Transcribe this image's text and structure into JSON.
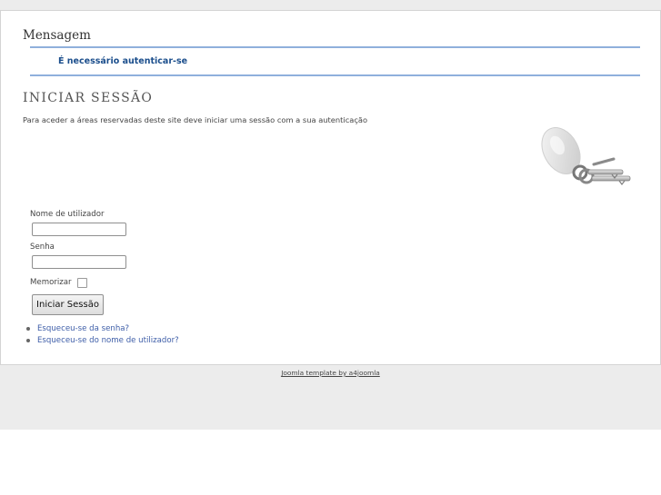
{
  "message": {
    "title": "Mensagem",
    "text": "É necessário autenticar-se"
  },
  "login": {
    "heading": "INICIAR SESSÃO",
    "description": "Para aceder a áreas reservadas deste site deve iniciar uma sessão com a sua autenticação",
    "username_label": "Nome de utilizador",
    "username_value": "",
    "password_label": "Senha",
    "password_value": "",
    "remember_label": "Memorizar",
    "remember_checked": false,
    "submit_label": "Iniciar Sessão",
    "image": "keys-icon"
  },
  "links": [
    {
      "label": "Esqueceu-se da senha?"
    },
    {
      "label": "Esqueceu-se do nome de utilizador?"
    }
  ],
  "footer": {
    "credit": "Joomla template by a4joomla"
  },
  "colors": {
    "accent_rule": "#8fb0dc",
    "message_text": "#1b4e8c",
    "link": "#3e5ea8",
    "page_background": "#ececec"
  }
}
